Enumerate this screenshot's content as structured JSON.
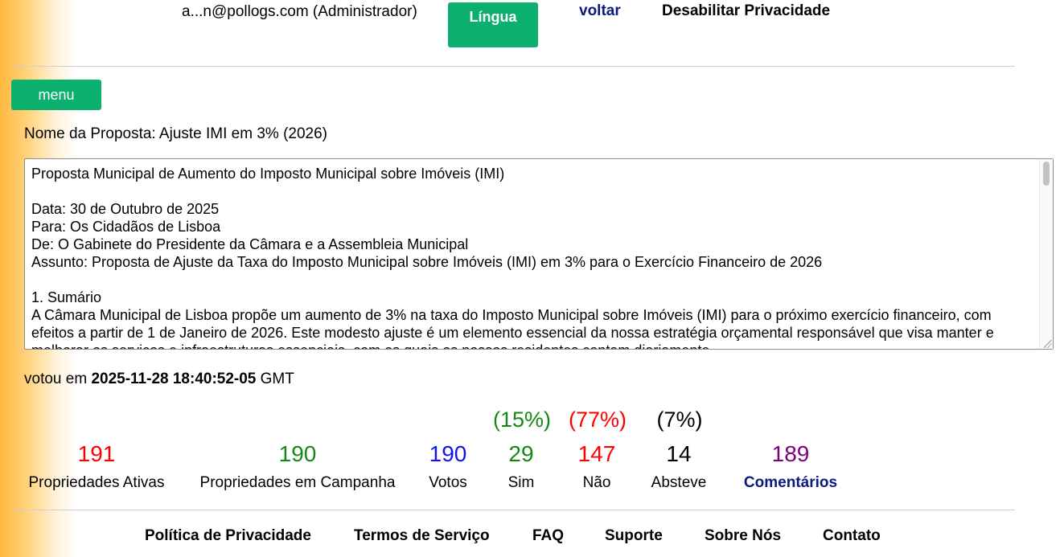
{
  "header": {
    "user_label": "a...n@pollogs.com (Administrador)",
    "language_button": "Língua",
    "back_link": "voltar",
    "privacy_toggle": "Desabilitar Privacidade"
  },
  "menu_button": "menu",
  "proposal": {
    "name_label": "Nome da Proposta: Ajuste IMI em 3% (2026)",
    "body": "Proposta Municipal de Aumento do Imposto Municipal sobre Imóveis (IMI)\n\nData: 30 de Outubro de 2025\nPara: Os Cidadãos de Lisboa\nDe: O Gabinete do Presidente da Câmara e a Assembleia Municipal\nAssunto: Proposta de Ajuste da Taxa do Imposto Municipal sobre Imóveis (IMI) em 3% para o Exercício Financeiro de 2026\n\n1. Sumário\nA Câmara Municipal de Lisboa propõe um aumento de 3% na taxa do Imposto Municipal sobre Imóveis (IMI) para o próximo exercício financeiro, com efeitos a partir de 1 de Janeiro de 2026. Este modesto ajuste é um elemento essencial da nossa estratégia orçamental responsável que visa manter e melhorar os serviços e infraestruturas essenciais, com os quais os nossos residentes contam diariamente."
  },
  "vote": {
    "prefix": "votou em",
    "timestamp": "2025-11-28 18:40:52-05",
    "suffix": "GMT"
  },
  "stats": {
    "yes_pct": "(15%)",
    "no_pct": "(77%)",
    "abstain_pct": "(7%)",
    "active_props": "191",
    "active_props_label": "Propriedades Ativas",
    "campaign_props": "190",
    "campaign_props_label": "Propriedades em Campanha",
    "votes": "190",
    "votes_label": "Votos",
    "yes": "29",
    "yes_label": "Sim",
    "no": "147",
    "no_label": "Não",
    "abstain": "14",
    "abstain_label": "Absteve",
    "comments": "189",
    "comments_label": "Comentários"
  },
  "colors": {
    "red": "#ff0000",
    "green": "#138913",
    "blue": "#1313ee",
    "purple": "#800080",
    "navy": "#0a1b7e",
    "button_green": "#0baf6e"
  },
  "footer": {
    "privacy": "Política de Privacidade",
    "terms": "Termos de Serviço",
    "faq": "FAQ",
    "support": "Suporte",
    "about": "Sobre Nós",
    "contact": "Contato"
  }
}
